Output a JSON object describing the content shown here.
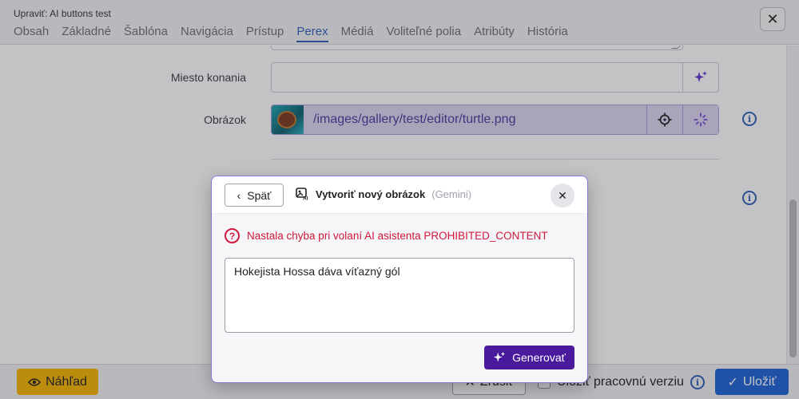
{
  "header": {
    "title": "Upraviť: AI buttons test",
    "tabs": [
      {
        "label": "Obsah",
        "active": false
      },
      {
        "label": "Základné",
        "active": false
      },
      {
        "label": "Šablóna",
        "active": false
      },
      {
        "label": "Navigácia",
        "active": false
      },
      {
        "label": "Prístup",
        "active": false
      },
      {
        "label": "Perex",
        "active": true
      },
      {
        "label": "Médiá",
        "active": false
      },
      {
        "label": "Voliteľné polia",
        "active": false
      },
      {
        "label": "Atribúty",
        "active": false
      },
      {
        "label": "História",
        "active": false
      }
    ],
    "close_icon": "close-icon"
  },
  "form": {
    "location_label": "Miesto konania",
    "location_value": "",
    "image_label": "Obrázok",
    "image_path": "/images/gallery/test/editor/turtle.png"
  },
  "footer": {
    "preview_label": "Náhľad",
    "cancel_label": "Zrušiť",
    "draft_label": "Uložiť pracovnú verziu",
    "save_label": "Uložiť"
  },
  "modal": {
    "back_label": "Späť",
    "title": "Vytvoriť nový obrázok",
    "subtitle": "(Gemini)",
    "error_message": "Nastala chyba pri volaní AI asistenta PROHIBITED_CONTENT",
    "prompt_value": "Hokejista Hossa dáva víťazný gól",
    "generate_label": "Generovať"
  },
  "colors": {
    "accent": "#2e5fb8",
    "error": "#d0183c",
    "ai_purple": "#4a1a9e",
    "preview_yellow": "#f5b400",
    "save_blue": "#1d63d6"
  }
}
